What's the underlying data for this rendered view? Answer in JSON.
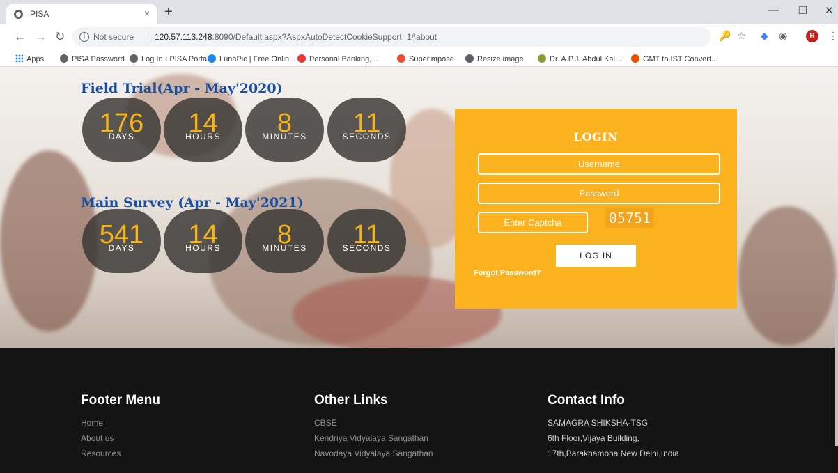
{
  "browser": {
    "tab_title": "PISA",
    "tab_close": "×",
    "new_tab": "+",
    "not_secure": "Not secure",
    "url_host": "120.57.113.248",
    "url_rest": ":8090/Default.aspx?AspxAutoDetectCookieSupport=1#about",
    "profile_initial": "R",
    "bookmarks": [
      {
        "label": "Apps",
        "icon": "apps-grid-icon",
        "color": "#1a73e8"
      },
      {
        "label": "PISA Password",
        "icon": "globe-icon",
        "color": "#5f6368"
      },
      {
        "label": "Log In ‹ PISA Portal...",
        "icon": "globe-icon",
        "color": "#5f6368"
      },
      {
        "label": "LunaPic | Free Onlin...",
        "icon": "lunapic-icon",
        "color": "#1e88e5"
      },
      {
        "label": "Personal Banking,...",
        "icon": "bank-icon",
        "color": "#e53935"
      },
      {
        "label": "Superimpose",
        "icon": "superimpose-icon",
        "color": "#e8503a"
      },
      {
        "label": "Resize image",
        "icon": "globe-icon",
        "color": "#5f6368"
      },
      {
        "label": "Dr. A.P.J. Abdul Kal...",
        "icon": "kalam-icon",
        "color": "#8d9a3b"
      },
      {
        "label": "GMT to IST Convert...",
        "icon": "clock-icon",
        "color": "#e65100"
      }
    ]
  },
  "countdowns": [
    {
      "title": "Field Trial(Apr - May'2020)",
      "units": [
        {
          "value": "176",
          "label": "DAYS"
        },
        {
          "value": "14",
          "label": "HOURS"
        },
        {
          "value": "8",
          "label": "MINUTES"
        },
        {
          "value": "11",
          "label": "SECONDS"
        }
      ]
    },
    {
      "title": "Main Survey (Apr - May'2021)",
      "units": [
        {
          "value": "541",
          "label": "DAYS"
        },
        {
          "value": "14",
          "label": "HOURS"
        },
        {
          "value": "8",
          "label": "MINUTES"
        },
        {
          "value": "11",
          "label": "SECONDS"
        }
      ]
    }
  ],
  "login": {
    "heading": "LOGIN",
    "username_placeholder": "Username",
    "password_placeholder": "Password",
    "captcha_placeholder": "Enter Captcha",
    "captcha_code": "05751",
    "button": "LOG IN",
    "forgot": "Forgot Password?"
  },
  "footer": {
    "menu": {
      "title": "Footer Menu",
      "items": [
        "Home",
        "About us",
        "Resources"
      ]
    },
    "links": {
      "title": "Other Links",
      "items": [
        "CBSE",
        "Kendriya Vidyalaya Sangathan",
        "Navodaya Vidyalaya Sangathan"
      ]
    },
    "contact": {
      "title": "Contact Info",
      "items": [
        "SAMAGRA SHIKSHA-TSG",
        "6th Floor,Vijaya Building,",
        "17th,Barakhambha New Delhi,India"
      ]
    }
  },
  "colors": {
    "accent": "#fbb21f",
    "title_blue": "#1a4fa0",
    "countdown_number": "#f5b51a",
    "footer_bg": "#141414"
  }
}
